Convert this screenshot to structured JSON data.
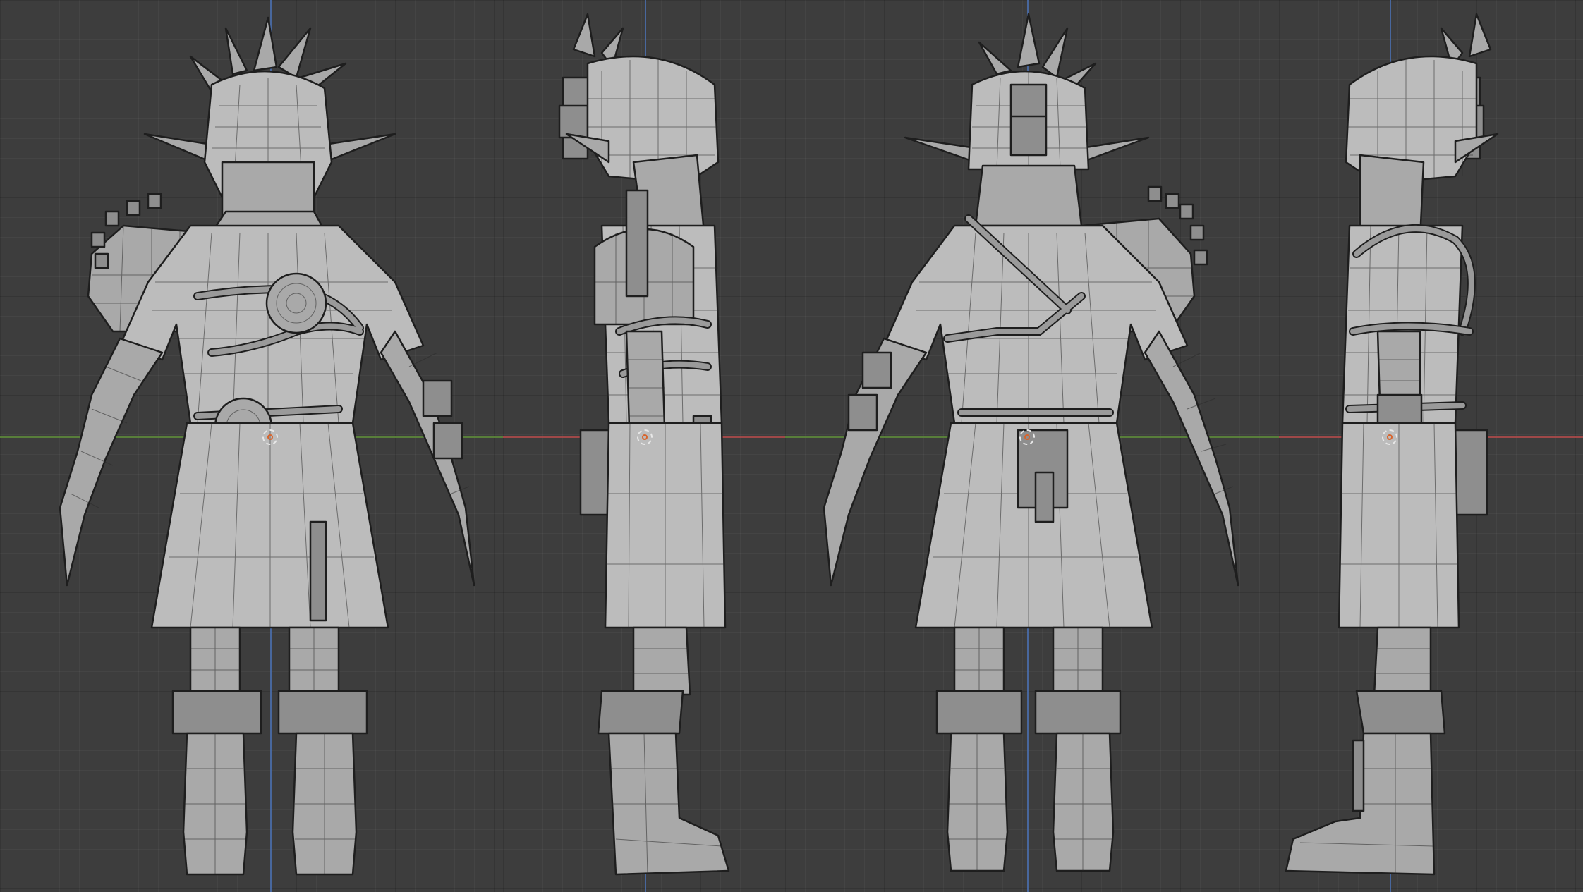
{
  "colors": {
    "background": "#3d3d3d",
    "grid_major": "#2f2f2f",
    "mesh_fill": "#a9a9a9",
    "mesh_edge": "#1e1e1e",
    "axis_x_red": "#b04a4a",
    "axis_y_green": "#5d8a3a",
    "axis_z_blue": "#4a6fae",
    "origin_marker": "#d8642c"
  },
  "viewports": [
    {
      "view": "front",
      "horizontal_axis": "green"
    },
    {
      "view": "right-side",
      "horizontal_axis": "red"
    },
    {
      "view": "back",
      "horizontal_axis": "green"
    },
    {
      "view": "left-side",
      "horizontal_axis": "red"
    }
  ],
  "icons": {
    "object_origin": "origin-dot-icon"
  }
}
